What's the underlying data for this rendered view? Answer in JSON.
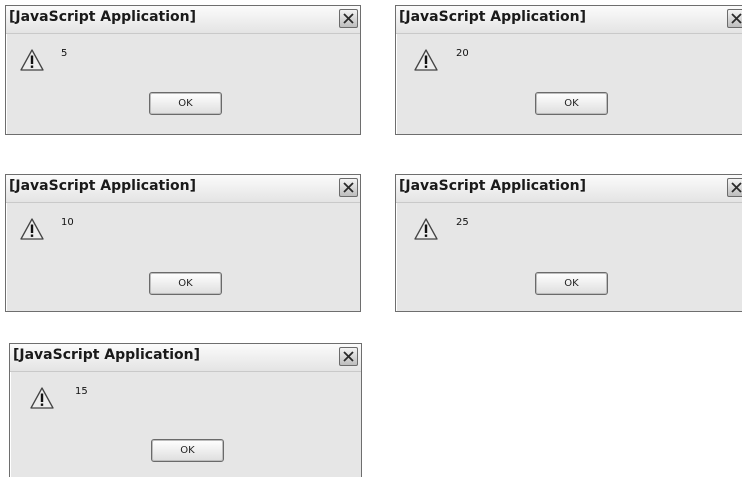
{
  "dialogs": [
    {
      "title": "[JavaScript Application]",
      "message": "5",
      "ok_label": "OK",
      "icon": "warning-icon"
    },
    {
      "title": "[JavaScript Application]",
      "message": "20",
      "ok_label": "OK",
      "icon": "warning-icon"
    },
    {
      "title": "[JavaScript Application]",
      "message": "10",
      "ok_label": "OK",
      "icon": "warning-icon"
    },
    {
      "title": "[JavaScript Application]",
      "message": "25",
      "ok_label": "OK",
      "icon": "warning-icon"
    },
    {
      "title": "[JavaScript Application]",
      "message": "15",
      "ok_label": "OK",
      "icon": "warning-icon"
    }
  ]
}
